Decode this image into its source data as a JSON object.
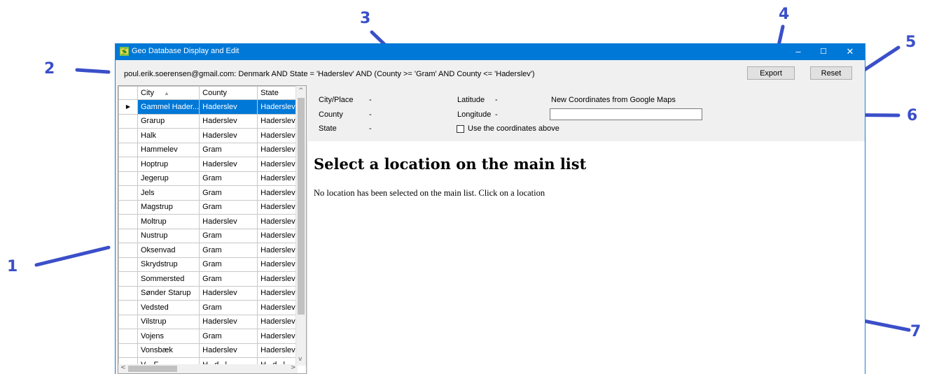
{
  "window": {
    "title": "Geo Database Display and Edit",
    "minimize_glyph": "–",
    "maximize_glyph": "☐",
    "close_glyph": "✕",
    "icon": "map-app-icon"
  },
  "toolbar": {
    "query_text": "poul.erik.soerensen@gmail.com: Denmark  AND State = 'Haderslev'  AND (County >= 'Gram' AND County <= 'Haderslev')",
    "export_label": "Export",
    "reset_label": "Reset"
  },
  "grid": {
    "columns": [
      "City",
      "County",
      "State"
    ],
    "sort_column": "City",
    "selected_marker": "▶",
    "rows": [
      {
        "city": "Gammel Hader...",
        "county": "Haderslev",
        "state": "Haderslev",
        "selected": true
      },
      {
        "city": "Grarup",
        "county": "Haderslev",
        "state": "Haderslev"
      },
      {
        "city": "Halk",
        "county": "Haderslev",
        "state": "Haderslev"
      },
      {
        "city": "Hammelev",
        "county": "Gram",
        "state": "Haderslev"
      },
      {
        "city": "Hoptrup",
        "county": "Haderslev",
        "state": "Haderslev"
      },
      {
        "city": "Jegerup",
        "county": "Gram",
        "state": "Haderslev"
      },
      {
        "city": "Jels",
        "county": "Gram",
        "state": "Haderslev"
      },
      {
        "city": "Magstrup",
        "county": "Gram",
        "state": "Haderslev"
      },
      {
        "city": "Moltrup",
        "county": "Haderslev",
        "state": "Haderslev"
      },
      {
        "city": "Nustrup",
        "county": "Gram",
        "state": "Haderslev"
      },
      {
        "city": "Oksenvad",
        "county": "Gram",
        "state": "Haderslev"
      },
      {
        "city": "Skrydstrup",
        "county": "Gram",
        "state": "Haderslev"
      },
      {
        "city": "Sommersted",
        "county": "Gram",
        "state": "Haderslev"
      },
      {
        "city": "Sønder Starup",
        "county": "Haderslev",
        "state": "Haderslev"
      },
      {
        "city": "Vedsted",
        "county": "Gram",
        "state": "Haderslev"
      },
      {
        "city": "Vilstrup",
        "county": "Haderslev",
        "state": "Haderslev"
      },
      {
        "city": "Vojens",
        "county": "Gram",
        "state": "Haderslev"
      },
      {
        "city": "Vonsbæk",
        "county": "Haderslev",
        "state": "Haderslev"
      },
      {
        "city": "V... F...",
        "county": "H...d...l...",
        "state": "H...d...l..."
      }
    ]
  },
  "details": {
    "city_label": "City/Place",
    "city_value": "-",
    "county_label": "County",
    "county_value": "-",
    "state_label": "State",
    "state_value": "-",
    "latitude_label": "Latitude",
    "latitude_value": "-",
    "longitude_label": "Longitude",
    "longitude_value": "-",
    "new_coords_label": "New Coordinates from Google Maps",
    "new_coords_value": "",
    "use_coords_label": "Use the coordinates above"
  },
  "browser": {
    "heading": "Select a location on the main list",
    "message": "No location has been selected on the main list. Click on a location"
  },
  "callouts": [
    "1",
    "2",
    "3",
    "4",
    "5",
    "6",
    "7"
  ],
  "colors": {
    "titlebar": "#0078d7",
    "selection": "#0078d7",
    "annotation": "#3b4fc9"
  }
}
